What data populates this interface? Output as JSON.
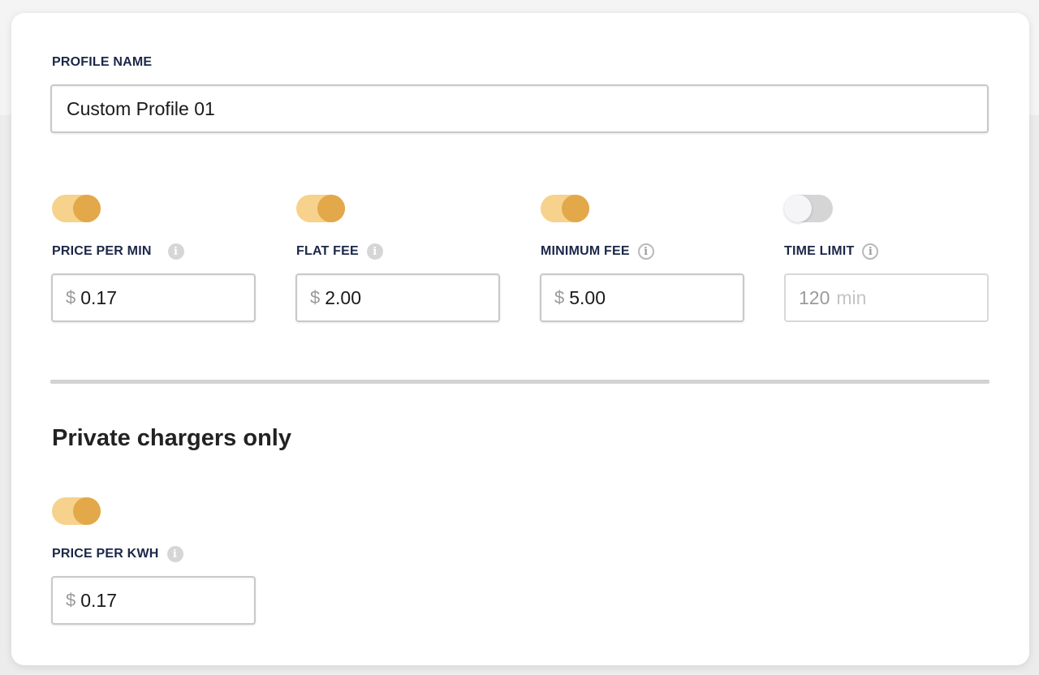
{
  "profile": {
    "label": "PROFILE NAME",
    "value": "Custom Profile 01"
  },
  "fields": [
    {
      "label": "PRICE PER MIN",
      "enabled": true,
      "prefix": "$",
      "value": "0.17"
    },
    {
      "label": "FLAT FEE",
      "enabled": true,
      "prefix": "$",
      "value": "2.00"
    },
    {
      "label": "MINIMUM FEE",
      "enabled": true,
      "prefix": "$",
      "value": "5.00"
    },
    {
      "label": "TIME LIMIT",
      "enabled": false,
      "value": "120",
      "suffix": "min"
    }
  ],
  "private_section": {
    "title": "Private chargers only",
    "field": {
      "label": "PRICE PER KWH",
      "enabled": true,
      "prefix": "$",
      "value": "0.17"
    }
  },
  "icons": {
    "info": "info-icon"
  },
  "colors": {
    "accent_track": "#f7d28c",
    "accent_knob": "#e2a84a",
    "label_text": "#1c2748"
  }
}
